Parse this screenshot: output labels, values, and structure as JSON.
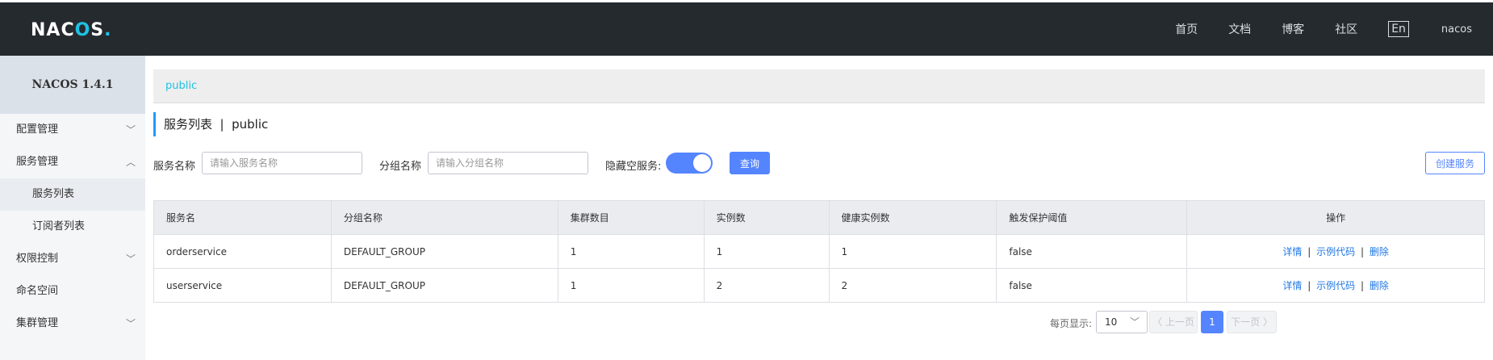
{
  "header": {
    "logo": "NAC",
    "logo_o": "O",
    "logo_tail": "S",
    "logo_dot": ".",
    "nav": [
      "首页",
      "文档",
      "博客",
      "社区"
    ],
    "lang": "En",
    "user": "nacos"
  },
  "sidebar": {
    "title": "NACOS 1.4.1",
    "items": [
      {
        "label": "配置管理",
        "chevron": "﹀"
      },
      {
        "label": "服务管理",
        "chevron": "︿"
      },
      {
        "label": "服务列表"
      },
      {
        "label": "订阅者列表"
      },
      {
        "label": "权限控制",
        "chevron": "﹀"
      },
      {
        "label": "命名空间"
      },
      {
        "label": "集群管理",
        "chevron": "﹀"
      }
    ]
  },
  "breadcrumb": {
    "namespace": "public"
  },
  "page": {
    "title": "服务列表  |  public"
  },
  "filters": {
    "service_label": "服务名称",
    "service_placeholder": "请输入服务名称",
    "group_label": "分组名称",
    "group_placeholder": "请输入分组名称",
    "hide_empty_label": "隐藏空服务:",
    "query_button": "查询",
    "create_button": "创建服务"
  },
  "table": {
    "columns": [
      "服务名",
      "分组名称",
      "集群数目",
      "实例数",
      "健康实例数",
      "触发保护阈值",
      "操作"
    ],
    "rows": [
      {
        "name": "orderservice",
        "group": "DEFAULT_GROUP",
        "clusters": "1",
        "instances": "1",
        "healthy": "1",
        "threshold": "false"
      },
      {
        "name": "userservice",
        "group": "DEFAULT_GROUP",
        "clusters": "1",
        "instances": "2",
        "healthy": "2",
        "threshold": "false"
      }
    ],
    "actions": {
      "detail": "详情",
      "sample": "示例代码",
      "delete": "删除",
      "sep": "|"
    }
  },
  "pagination": {
    "per_page_label": "每页显示:",
    "per_page_value": "10",
    "prev": "〈 上一页",
    "current": "1",
    "next": "下一页 〉"
  }
}
